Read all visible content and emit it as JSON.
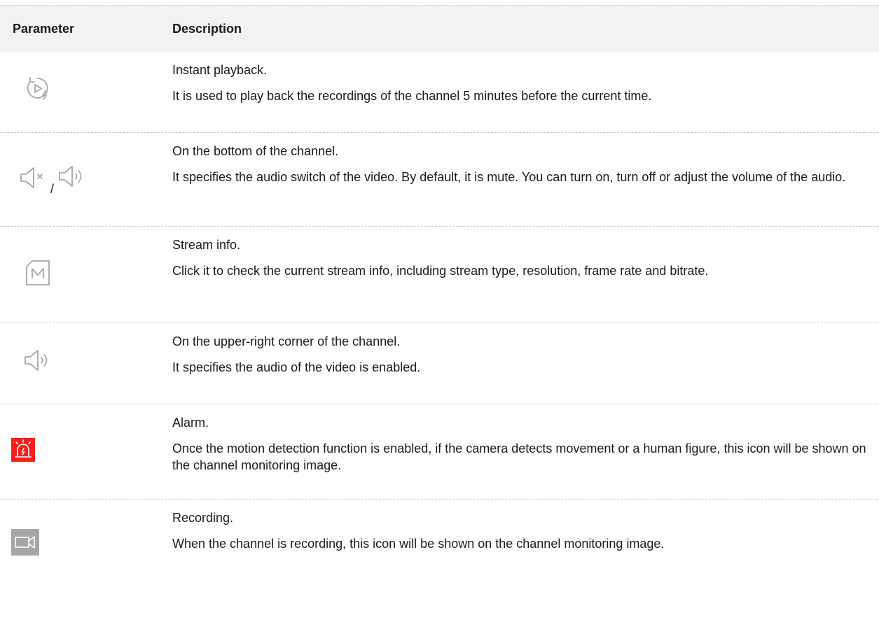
{
  "table": {
    "header": {
      "parameter": "Parameter",
      "description": "Description"
    },
    "rows": [
      {
        "icons": [
          "instant-playback-icon"
        ],
        "title": "Instant playback.",
        "body": "It is used to play back the recordings of the channel 5 minutes before the current time."
      },
      {
        "icons": [
          "audio-mute-icon",
          "audio-on-icon"
        ],
        "separator": "/",
        "title": "On the bottom of the channel.",
        "body": "It specifies the audio switch of the video. By default, it is mute. You can turn on, turn off or adjust the volume of the audio."
      },
      {
        "icons": [
          "stream-info-icon"
        ],
        "title": "Stream info.",
        "body": "Click it to check the current stream info, including stream type, resolution, frame rate and bitrate."
      },
      {
        "icons": [
          "audio-enabled-icon"
        ],
        "title": "On the upper-right corner of the channel.",
        "body": "It specifies the audio of the video is enabled."
      },
      {
        "icons": [
          "alarm-icon"
        ],
        "title": "Alarm.",
        "body": "Once the motion detection function is enabled, if the camera detects movement or a human figure, this icon will be shown on the channel monitoring image."
      },
      {
        "icons": [
          "recording-icon"
        ],
        "title": "Recording.",
        "body": "When the channel is recording, this icon will be shown on the channel monitoring image."
      }
    ]
  },
  "colors": {
    "icon_gray": "#a6a6a6",
    "alarm_red": "#f5201c",
    "recording_bg": "#a6a6a6",
    "header_bg": "#f2f2f2",
    "divider": "#c8c8c8"
  }
}
